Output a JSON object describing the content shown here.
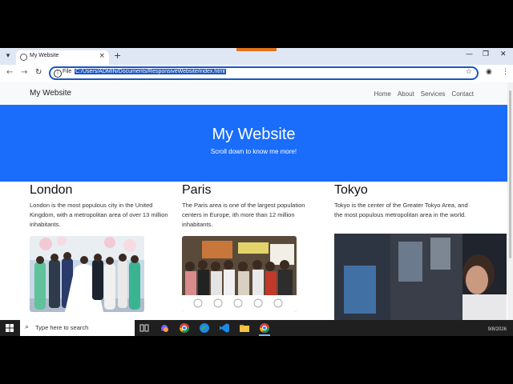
{
  "browser": {
    "tab_title": "My Website",
    "new_tab_symbol": "+",
    "close_symbol": "×",
    "file_label": "File",
    "url": "C:/Users/ADMIN/Documents/ResponsiveWebsite/index.html"
  },
  "site": {
    "brand": "My Website",
    "nav": [
      "Home",
      "About",
      "Services",
      "Contact"
    ],
    "hero_title": "My Website",
    "hero_subtitle": "Scroll down to know me more!",
    "cities": [
      {
        "name": "London",
        "text": "London is the most populous city in the United Kingdom, with a metropolitan area of over 13 million inhabitants."
      },
      {
        "name": "Paris",
        "text": "The Paris area is one of the largest population centers in Europe, ith more than 12 million inhabitants."
      },
      {
        "name": "Tokyo",
        "text": "Tokyo is the center of the Greater Tokyo Area, and the most populous metropolitan area in the world."
      }
    ]
  },
  "taskbar": {
    "search_placeholder": "Type here to search",
    "date": "9/8/2026"
  },
  "colors": {
    "hero_bg": "#1a6dfb",
    "accent": "#1a56c4",
    "recording_bar": "#e2721b"
  }
}
